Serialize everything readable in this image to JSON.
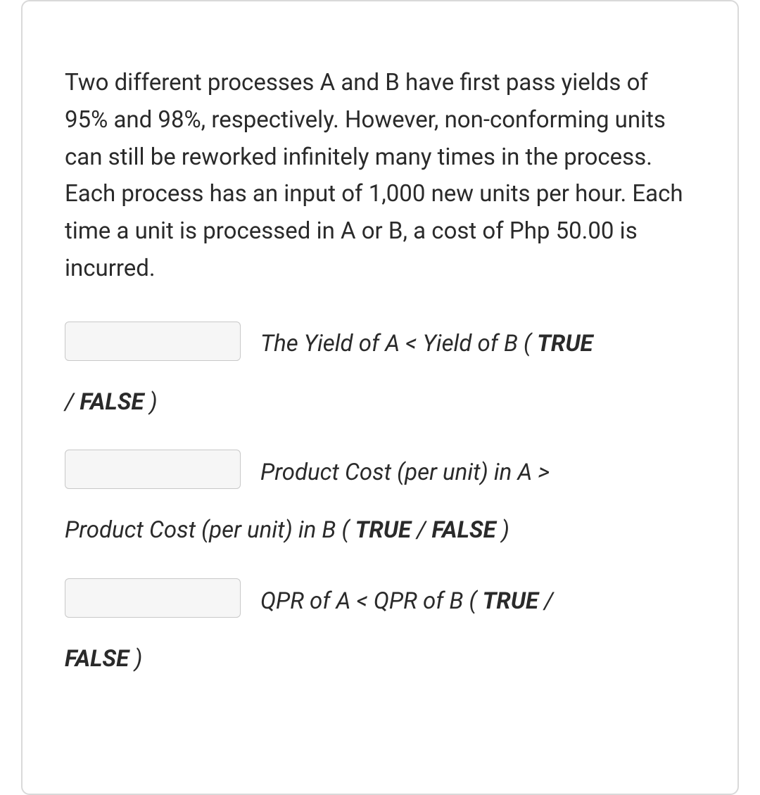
{
  "question": {
    "text": "Two different processes A and B have first pass yields of 95% and 98%, respectively. However, non-conforming units can still be reworked infinitely many times in the process. Each process has an input of 1,000 new units per hour. Each time a unit is processed in A or B, a cost of Php 50.00 is incurred."
  },
  "statements": [
    {
      "input_value": "",
      "prompt_line1_italic": "The Yield of A < Yield of B ( ",
      "prompt_line1_bold": "TRUE",
      "continuation_prefix": "/  ",
      "continuation_bold": "FALSE",
      "continuation_suffix": " )"
    },
    {
      "input_value": "",
      "prompt_line1_italic": "Product Cost (per unit) in A >",
      "prompt_line1_bold": "",
      "continuation_italic_a": "Product Cost (per unit) in B ( ",
      "continuation_bold_a": "TRUE",
      "continuation_mid": "  /  ",
      "continuation_bold_b": "FALSE",
      "continuation_suffix": " )"
    },
    {
      "input_value": "",
      "prompt_line1_italic": "QPR of A < QPR of B ( ",
      "prompt_line1_bold": "TRUE",
      "prompt_line1_suffix": "  /",
      "continuation_bold": "FALSE",
      "continuation_suffix": " )"
    }
  ]
}
